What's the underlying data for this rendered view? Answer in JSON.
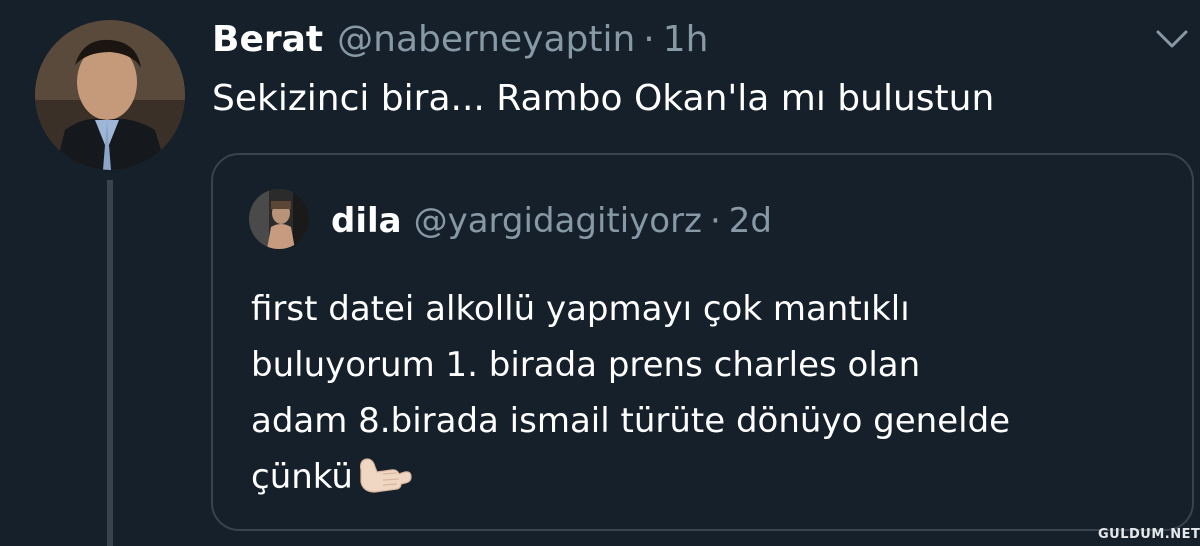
{
  "tweet": {
    "author": {
      "name": "Berat",
      "handle": "@naberneyaptin",
      "separator": "·",
      "time": "1h",
      "avatar_icon": "profile-photo-man-in-suit"
    },
    "text": "Sekizinci bira... Rambo Okan'la mı bulustun",
    "menu_icon": "chevron-down-icon"
  },
  "quoted_tweet": {
    "author": {
      "name": "dila",
      "handle": "@yargidagitiyorz",
      "separator": "·",
      "time": "2d",
      "avatar_icon": "profile-photo"
    },
    "text_lines": [
      "first datei alkollü yapmayı çok mantıklı",
      "buluyorum 1. birada prens charles olan",
      "adam 8.birada ismail türüte dönüyo genelde",
      "çünkü"
    ],
    "emoji": "call-me-hand-emoji"
  },
  "watermark": "GULDUM.NET",
  "colors": {
    "background": "#15202b",
    "border": "#38444d",
    "secondary_text": "#8899a6",
    "primary_text": "#ffffff"
  }
}
